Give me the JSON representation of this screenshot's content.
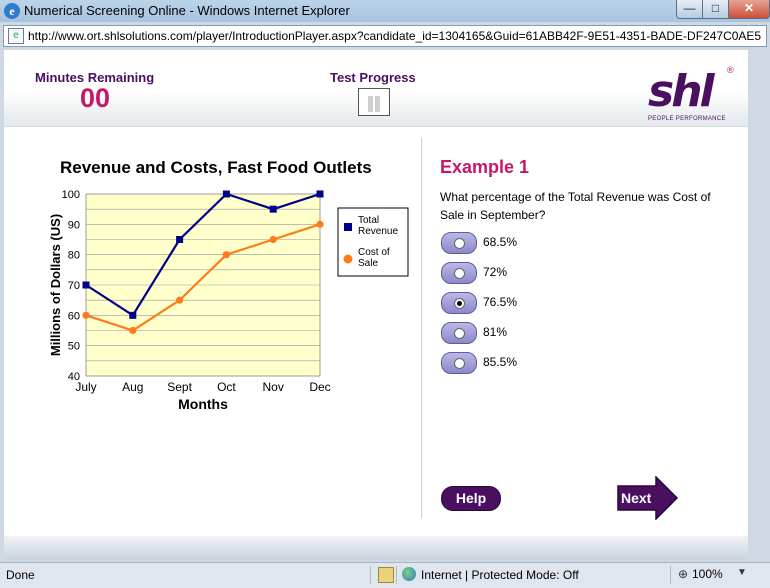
{
  "window": {
    "title": "Numerical Screening Online - Windows Internet Explorer",
    "url": "http://www.ort.shlsolutions.com/player/IntroductionPlayer.aspx?candidate_id=1304165&Guid=61ABB42F-9E51-4351-BADE-DF247C0AE5",
    "min_glyph": "—",
    "max_glyph": "□",
    "close_glyph": "✕"
  },
  "header": {
    "minutes_label": "Minutes Remaining",
    "minutes_value": "00",
    "progress_label": "Test Progress",
    "logo_text": "shl",
    "logo_tagline": "PEOPLE PERFORMANCE",
    "logo_reg": "®"
  },
  "chart_data": {
    "type": "line",
    "title": "Revenue and Costs, Fast Food Outlets",
    "xlabel": "Months",
    "ylabel": "Millions of Dollars (US)",
    "categories": [
      "July",
      "Aug",
      "Sept",
      "Oct",
      "Nov",
      "Dec"
    ],
    "ylim": [
      40,
      100
    ],
    "yticks": [
      40,
      50,
      60,
      70,
      80,
      90,
      100
    ],
    "grid": true,
    "legend": "right",
    "series": [
      {
        "name": "Total Revenue",
        "color": "#00008b",
        "values": [
          70,
          60,
          85,
          100,
          95,
          100
        ]
      },
      {
        "name": "Cost of Sale",
        "color": "#ff7a1a",
        "values": [
          60,
          55,
          65,
          80,
          85,
          90
        ]
      }
    ]
  },
  "question": {
    "title": "Example 1",
    "text": "What percentage of the Total Revenue was Cost of Sale in September?",
    "options": [
      {
        "label": "68.5%",
        "selected": false
      },
      {
        "label": "72%",
        "selected": false
      },
      {
        "label": "76.5%",
        "selected": true
      },
      {
        "label": "81%",
        "selected": false
      },
      {
        "label": "85.5%",
        "selected": false
      }
    ]
  },
  "buttons": {
    "help": "Help",
    "next": "Next"
  },
  "statusbar": {
    "status": "Done",
    "zone": "Internet | Protected Mode: Off",
    "zoom": "100%"
  }
}
